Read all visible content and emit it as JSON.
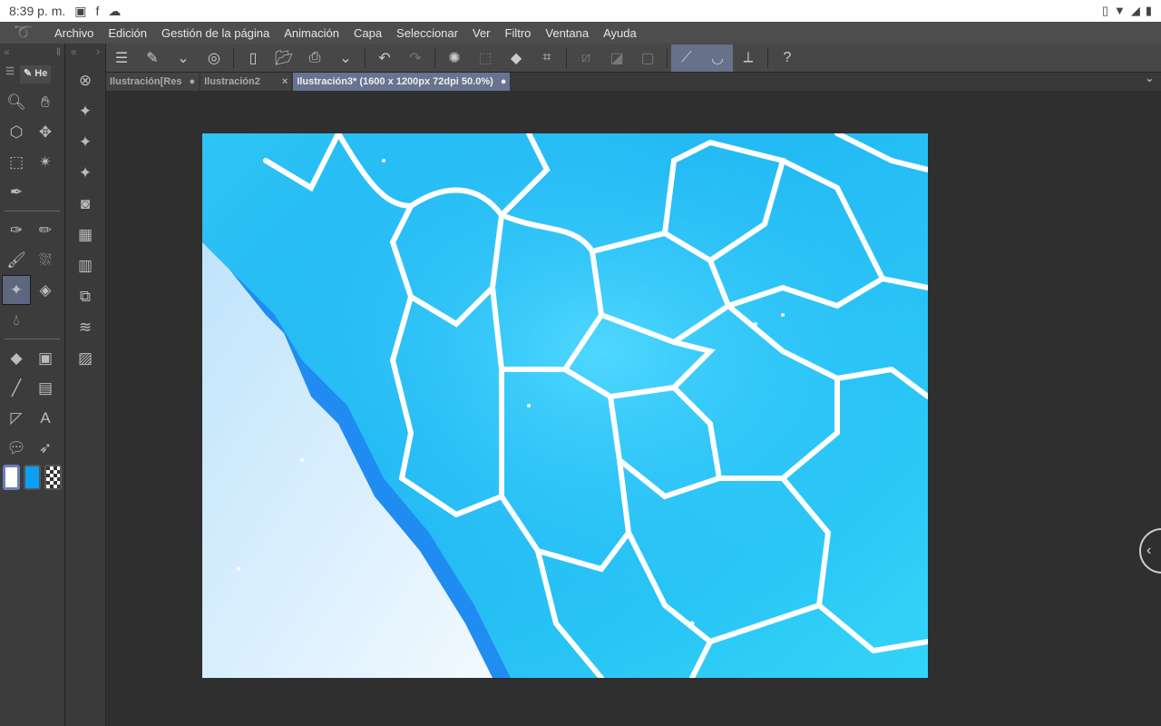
{
  "status": {
    "time": "8:39 p. m."
  },
  "menu": [
    "Archivo",
    "Edición",
    "Gestión de la página",
    "Animación",
    "Capa",
    "Seleccionar",
    "Ver",
    "Filtro",
    "Ventana",
    "Ayuda"
  ],
  "tabs": [
    {
      "label": "Ilustración[Res",
      "mark": "●"
    },
    {
      "label": "Ilustración2",
      "mark": "×"
    },
    {
      "label": "Ilustración3* (1600 x 1200px 72dpi 50.0%)",
      "mark": "●"
    }
  ],
  "panel": {
    "tab_label": "He"
  },
  "colors": {
    "main": "#ffffff",
    "sub": "#0aa0f5",
    "accent": "#67718a"
  }
}
